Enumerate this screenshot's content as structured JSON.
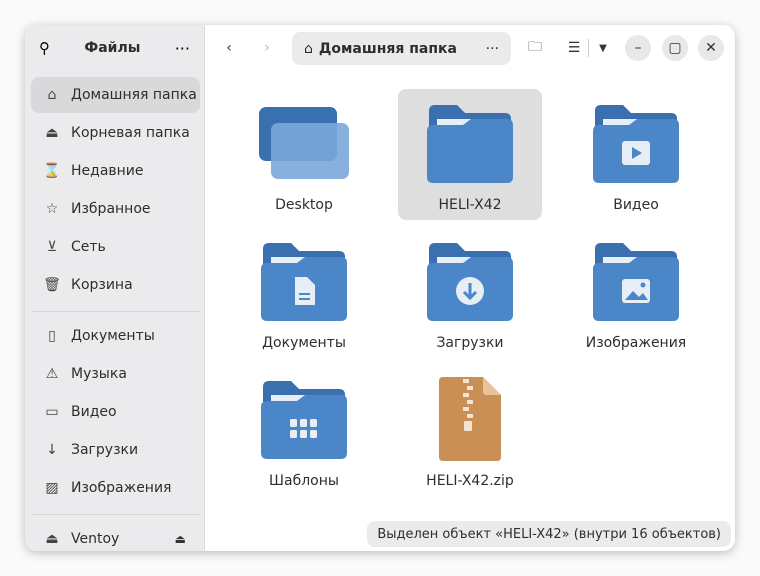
{
  "sidebar": {
    "title": "Файлы",
    "places": [
      {
        "label": "Домашняя папка",
        "icon": "home-icon"
      },
      {
        "label": "Корневая папка",
        "icon": "drive-icon"
      },
      {
        "label": "Недавние",
        "icon": "hourglass-icon"
      },
      {
        "label": "Избранное",
        "icon": "star-icon"
      },
      {
        "label": "Сеть",
        "icon": "network-icon"
      },
      {
        "label": "Корзина",
        "icon": "trash-icon"
      }
    ],
    "bookmarks": [
      {
        "label": "Документы",
        "icon": "document-icon"
      },
      {
        "label": "Музыка",
        "icon": "warning-icon"
      },
      {
        "label": "Видео",
        "icon": "camera-icon"
      },
      {
        "label": "Загрузки",
        "icon": "download-icon"
      },
      {
        "label": "Изображения",
        "icon": "image-icon"
      }
    ],
    "devices": [
      {
        "label": "Ventoy",
        "icon": "drive-icon"
      }
    ]
  },
  "header": {
    "path": "Домашняя папка"
  },
  "files": [
    {
      "name": "Desktop",
      "type": "desktop"
    },
    {
      "name": "HELI-X42",
      "type": "folder",
      "selected": true
    },
    {
      "name": "Видео",
      "type": "video"
    },
    {
      "name": "Документы",
      "type": "documents"
    },
    {
      "name": "Загрузки",
      "type": "downloads"
    },
    {
      "name": "Изображения",
      "type": "pictures"
    },
    {
      "name": "Шаблоны",
      "type": "templates"
    },
    {
      "name": "HELI-X42.zip",
      "type": "zip"
    }
  ],
  "status": "Выделен объект «HELI-X42» (внутри 16 объектов)",
  "colors": {
    "folder": "#4a86c8",
    "folder_back": "#3a6fb0",
    "zip": "#c98f55"
  }
}
